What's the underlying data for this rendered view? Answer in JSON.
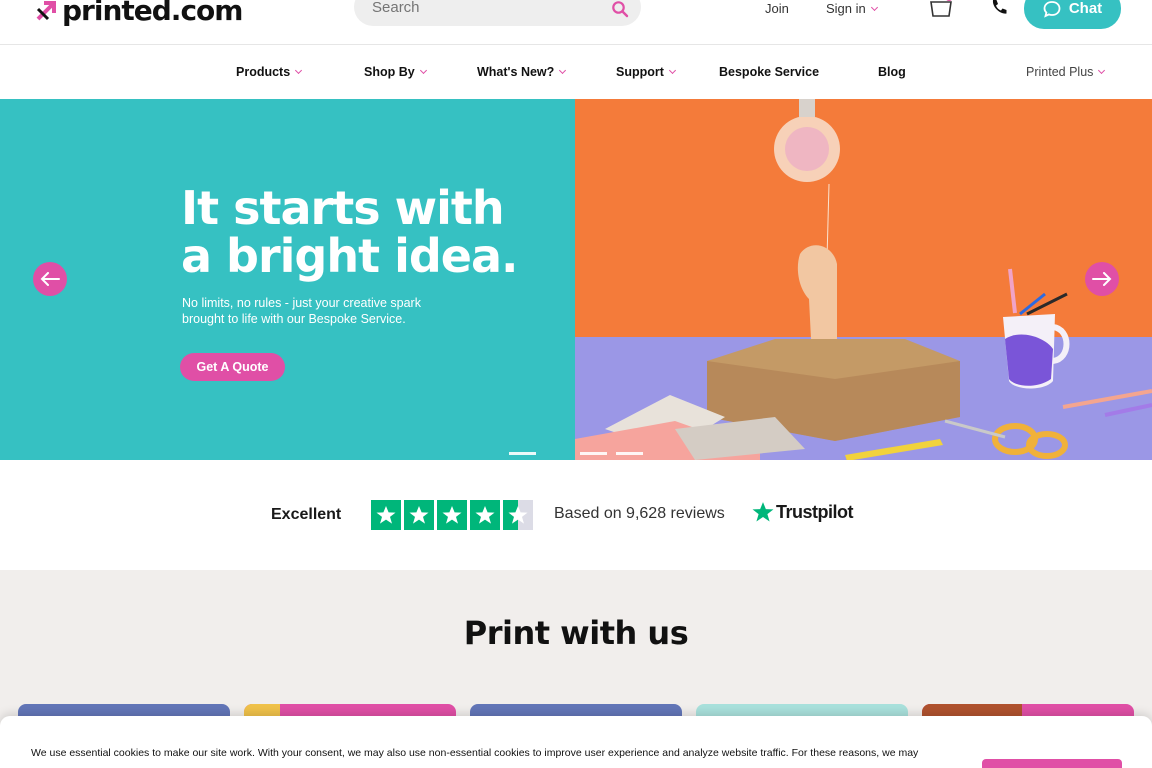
{
  "header": {
    "logo_text": "printed.com",
    "search_placeholder": "Search",
    "join": "Join",
    "sign_in": "Sign in",
    "chat": "Chat"
  },
  "nav": {
    "items": [
      {
        "label": "Products"
      },
      {
        "label": "Shop By"
      },
      {
        "label": "What's New?"
      },
      {
        "label": "Support"
      },
      {
        "label": "Bespoke Service"
      },
      {
        "label": "Blog"
      },
      {
        "label": "Printed Plus"
      }
    ]
  },
  "hero": {
    "title_line1": "It starts with",
    "title_line2": "a bright idea.",
    "subtitle_line1": "No limits, no rules - just your creative spark",
    "subtitle_line2": "brought to life with our Bespoke Service.",
    "cta": "Get A Quote"
  },
  "trust": {
    "rating_word": "Excellent",
    "stars": 4.5,
    "reviews": "Based on 9,628 reviews",
    "brand": "Trustpilot"
  },
  "print_section": {
    "title": "Print with us"
  },
  "cookie": {
    "text": "We use essential cookies to make our site work. With your consent, we may also use non-essential cookies to improve user experience and analyze website traffic. For these reasons, we may"
  },
  "colors": {
    "brand_pink": "#e04fa6",
    "teal": "#36c1c2",
    "orange": "#f47b3a",
    "lilac": "#9b97e6"
  }
}
